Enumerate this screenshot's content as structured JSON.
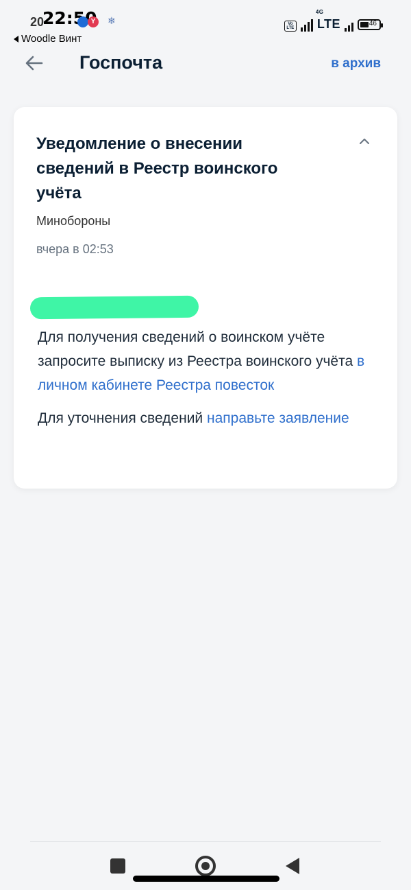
{
  "status_bar": {
    "time": "22:50",
    "time_underlay": "20",
    "network": "LTE",
    "network_gen": "4G",
    "volte": "Vo LTE",
    "battery_level": "46",
    "back_app_label": "Woodle Винт"
  },
  "header": {
    "title": "Госпочта",
    "archive_label": "в архив"
  },
  "message": {
    "title": "Уведомление о внесении сведений в Реестр воинского учёта",
    "sender": "Минобороны",
    "date": "вчера в 02:53",
    "para1_text": "Для получения сведений о воинском учёте запросите выписку из Реестра воинского учёта ",
    "para1_link": "в личном кабинете Реестра повесток",
    "para2_text": "Для уточнения сведений ",
    "para2_link": "направьте заявление"
  },
  "colors": {
    "accent": "#2f6fcc",
    "redaction": "#3ff5a6",
    "background": "#f4f5f7"
  }
}
